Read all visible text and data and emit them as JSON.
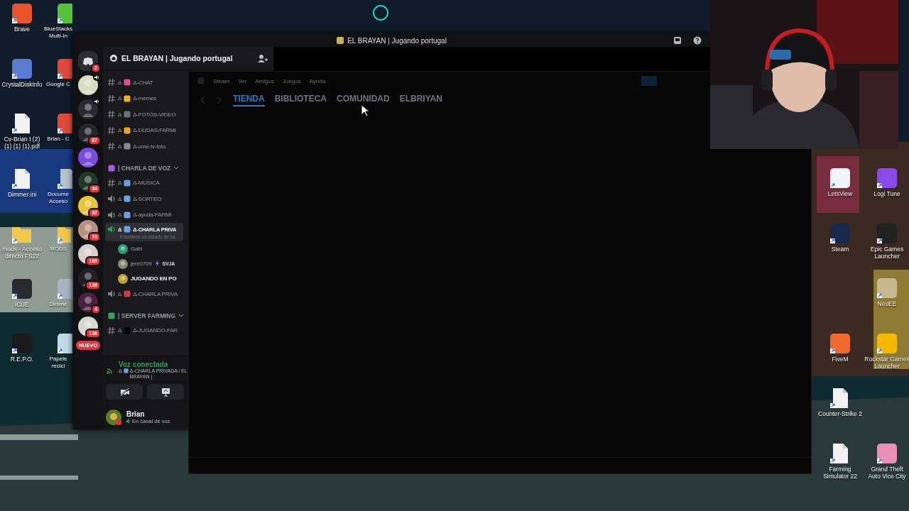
{
  "desktop": {
    "left_icons": [
      {
        "kind": "app",
        "color": "#e8552d",
        "label": "Brave"
      },
      {
        "kind": "app",
        "color": "#55c23a",
        "label": "BlueStacks Multi-In"
      },
      {
        "kind": "app",
        "color": "#5a7bd0",
        "label": "CrystalDiskInfo"
      },
      {
        "kind": "app",
        "color": "#e04a3a",
        "label": "Google C"
      },
      {
        "kind": "file",
        "color": "#f2f2f2",
        "label": "Cv-Brian t (2) (1) (1) (1).pdf"
      },
      {
        "kind": "app",
        "color": "#e04a3a",
        "label": "Brian - C"
      },
      {
        "kind": "file",
        "color": "#f2f2f2",
        "label": "Dimmer.ini"
      },
      {
        "kind": "file",
        "color": "#b8c0c8",
        "label": "Docume Acceso"
      },
      {
        "kind": "folder",
        "color": "#f0c84a",
        "label": "mods - Acceso directo FS22"
      },
      {
        "kind": "folder",
        "color": "#f0c84a",
        "label": "MODS"
      },
      {
        "kind": "app",
        "color": "#2a2a33",
        "label": "iCUE"
      },
      {
        "kind": "app",
        "color": "#a8b4c0",
        "label": "Dimme"
      },
      {
        "kind": "app",
        "color": "#1a1a1a",
        "label": "R.E.P.O."
      },
      {
        "kind": "app",
        "color": "#c0d8e8",
        "label": "Papele recicl"
      }
    ],
    "right_icons": [
      {
        "kind": "app",
        "color": "#eef4f8",
        "label": "LetsView"
      },
      {
        "kind": "app",
        "color": "#8a4ae8",
        "label": "Logi Tune"
      },
      {
        "kind": "app",
        "color": "#1b2a4a",
        "label": "Steam"
      },
      {
        "kind": "app",
        "color": "#222222",
        "label": "Epic Games Launcher"
      },
      {
        "kind": "app",
        "color": "#c8b890",
        "label": "NeoEE"
      },
      {
        "kind": "app",
        "color": "#f06a30",
        "label": "FiveM"
      },
      {
        "kind": "app",
        "color": "#f5b800",
        "label": "Rockstar Games Launcher"
      },
      {
        "kind": "file",
        "color": "#f2f2f2",
        "label": "Counter-Strike 2"
      },
      {
        "kind": "file",
        "color": "#f2f2f2",
        "label": "Farming Simulator 22"
      },
      {
        "kind": "app",
        "color": "#e890b8",
        "label": "Grand Theft Auto Vice City"
      }
    ]
  },
  "discord": {
    "title": "EL BRAYAN | Jugando portugal",
    "home_badge": "2",
    "servers": [
      {
        "color": "#d8dcc0",
        "speaking": true
      },
      {
        "color": "#2a2a35",
        "speaking": true
      },
      {
        "color": "#26262c",
        "speaking": false,
        "badge": "87"
      },
      {
        "color": "#7a4ad8",
        "speaking": false
      },
      {
        "color": "#1f3a2a",
        "speaking": false,
        "badge": "34"
      },
      {
        "color": "#e8c43a",
        "speaking": false,
        "badge": "32"
      },
      {
        "color": "#b89080",
        "speaking": false,
        "badge": "73"
      },
      {
        "color": "#d8d0cc",
        "speaking": false,
        "badge": "189"
      },
      {
        "color": "#202025",
        "speaking": false,
        "badge": "139"
      },
      {
        "color": "#4a2040",
        "speaking": false,
        "badge": "4"
      },
      {
        "color": "#d8d8d0",
        "speaking": false,
        "badge": "136"
      }
    ],
    "new_label": "NUEVO",
    "server_name": "EL BRAYAN | Jugando portugal",
    "channels": [
      {
        "kind": "text",
        "prefix": "Δ",
        "name": "Δ-CHAT",
        "selected": false
      },
      {
        "kind": "text",
        "prefix": "Δ",
        "name": "Δ-memes",
        "selected": false
      },
      {
        "kind": "text",
        "prefix": "Δ",
        "name": "Δ-FOTOS-VIDEO",
        "selected": false
      },
      {
        "kind": "text",
        "prefix": "Δ",
        "name": "Δ-DUDAS-FARMI",
        "selected": false
      },
      {
        "kind": "text",
        "prefix": "Δ",
        "name": "Δ-ome-tv-foto",
        "selected": false
      },
      {
        "kind": "category",
        "name": "| CHARLA DE VOZ",
        "expanded": true
      },
      {
        "kind": "text",
        "prefix": "Δ",
        "name": "Δ-MUSICA",
        "selected": false
      },
      {
        "kind": "voice",
        "prefix": "Δ",
        "name": "Δ-SORTEO",
        "selected": false
      },
      {
        "kind": "voice",
        "prefix": "Δ",
        "name": "Δ-ayuda-FARMI",
        "selected": false
      },
      {
        "kind": "voice",
        "prefix": "Δ",
        "name": "Δ-CHARLA PRIVA",
        "selected": true,
        "status": "Establece un estado de ca",
        "users": [
          {
            "name": "Gabi",
            "highlighted": false
          },
          {
            "name": "jere0709",
            "highlighted": false,
            "tag": "SVJA"
          },
          {
            "name": "JUGANDO EN PO",
            "highlighted": true
          }
        ]
      },
      {
        "kind": "voice",
        "prefix": "Δ",
        "name": "Δ-CHARLA PRIVA",
        "selected": false
      },
      {
        "kind": "category",
        "name": "| SERVER FARMING",
        "expanded": true
      },
      {
        "kind": "text",
        "prefix": "Δ",
        "name": "Δ-JUGANDO-FAR",
        "selected": false
      }
    ],
    "voice_panel": {
      "status": "Voz conectada",
      "prefix": "Δ",
      "location": "Δ-CHARLA PRIVADA / EL BRAYAN |"
    },
    "user": {
      "name": "Brian",
      "status": "En canal de voz"
    }
  },
  "steam": {
    "menu": [
      "Steam",
      "Ver",
      "Amigos",
      "Juegos",
      "Ayuda"
    ],
    "tabs": [
      {
        "label": "TIENDA",
        "selected": true
      },
      {
        "label": "BIBLIOTECA",
        "selected": false
      },
      {
        "label": "COMUNIDAD",
        "selected": false
      },
      {
        "label": "ELBRIYAN",
        "selected": false
      }
    ]
  }
}
